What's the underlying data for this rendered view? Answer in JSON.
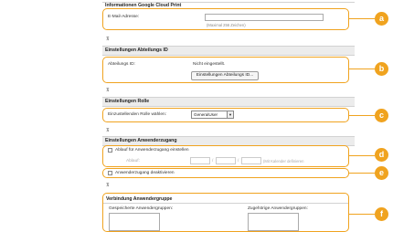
{
  "google": {
    "title": "Informationen Google Cloud Print",
    "email_label": "E-Mail-Adresse:",
    "email_hint": "(Maximal 256 Zeichen)"
  },
  "dept": {
    "title": "Einstellungen Abteilungs ID",
    "id_label": "Abteilungs ID:",
    "id_value": "Nicht eingestellt.",
    "button": "Einstellungen Abteilungs ID..."
  },
  "role": {
    "title": "Einstellungen Rolle",
    "label": "Einzustellenden Rolle wählen:",
    "selected": "GeneralUser"
  },
  "access": {
    "title": "Einstellungen Anwenderzugang",
    "expiry_label": "Ablauf für Anwenderzugang einstellen",
    "date_label": "Ablauf:",
    "date_sep1": "/",
    "date_sep2": "/",
    "date_hint": "(Mit Kalender definieren",
    "disable_label": "Anwenderzugang deaktivieren"
  },
  "groups": {
    "title": "Verbindung Anwendergruppe",
    "left_label": "Gespeicherte Anwendergruppen:",
    "right_label": "Zugehörige Anwendergruppen:"
  },
  "collapse_glyph": "⊼",
  "badges": [
    "a",
    "b",
    "c",
    "d",
    "e",
    "f"
  ],
  "accent_color": "#f0a31f"
}
